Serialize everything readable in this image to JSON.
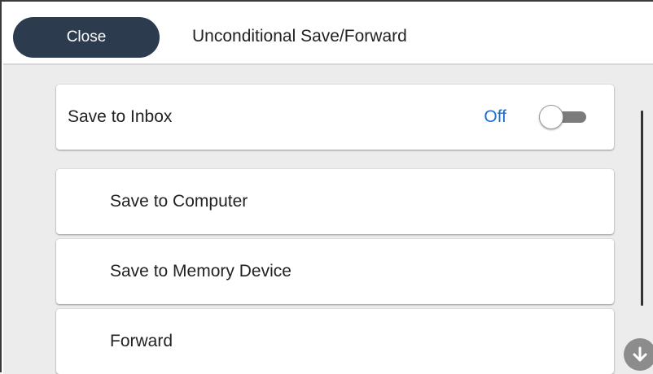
{
  "header": {
    "close_label": "Close",
    "title": "Unconditional Save/Forward"
  },
  "settings": {
    "save_to_inbox": {
      "label": "Save to Inbox",
      "status": "Off",
      "enabled": false
    },
    "items": [
      {
        "label": "Save to Computer"
      },
      {
        "label": "Save to Memory Device"
      },
      {
        "label": "Forward"
      }
    ]
  },
  "icons": {
    "toggle": "toggle-switch-icon",
    "scroll_down": "arrow-down-icon"
  },
  "colors": {
    "close_button": "#2d3b4f",
    "status_text": "#1f6fd1",
    "content_background": "#ececec"
  }
}
